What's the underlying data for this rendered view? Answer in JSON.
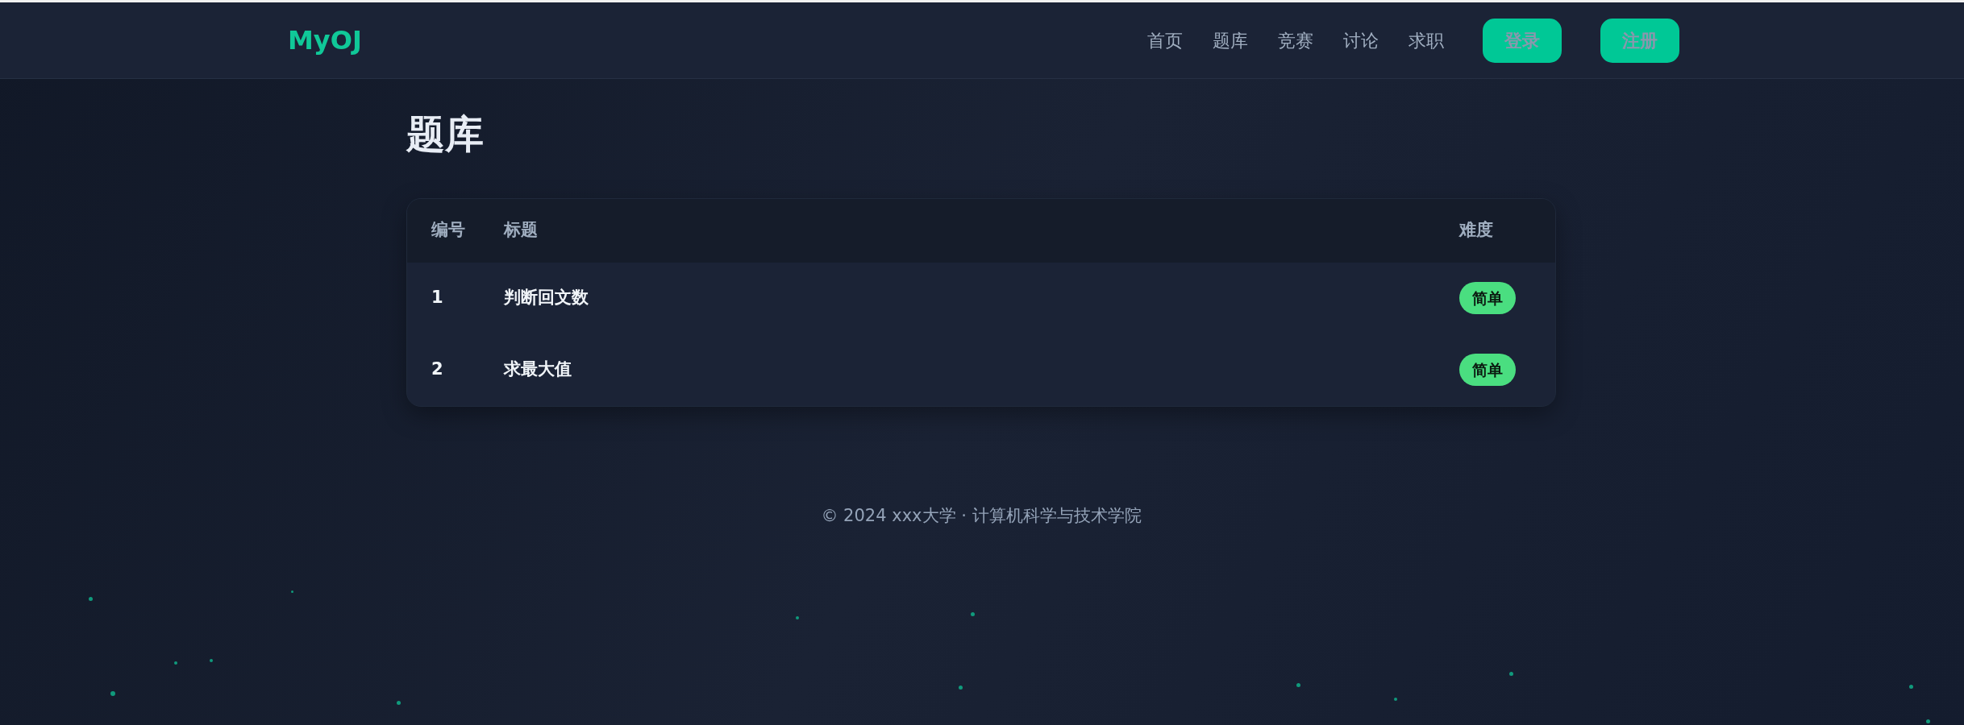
{
  "navbar": {
    "brand": "MyOJ",
    "items": [
      {
        "kind": "link",
        "label": "首页"
      },
      {
        "kind": "link",
        "label": "题库"
      },
      {
        "kind": "link",
        "label": "竞赛"
      },
      {
        "kind": "link",
        "label": "讨论"
      },
      {
        "kind": "link",
        "label": "求职"
      },
      {
        "kind": "button",
        "label": "登录"
      },
      {
        "kind": "button",
        "label": "注册"
      }
    ]
  },
  "page_title": "题库",
  "table": {
    "columns": [
      "编号",
      "标题",
      "难度"
    ],
    "rows": [
      {
        "id": "1",
        "title": "判断回文数",
        "difficulty": "简单",
        "color": "#4ade80"
      },
      {
        "id": "2",
        "title": "求最大值",
        "difficulty": "简单",
        "color": "#4ade80"
      }
    ]
  },
  "footer": "© 2024 xxx大学 · 计算机科学与技术学院"
}
